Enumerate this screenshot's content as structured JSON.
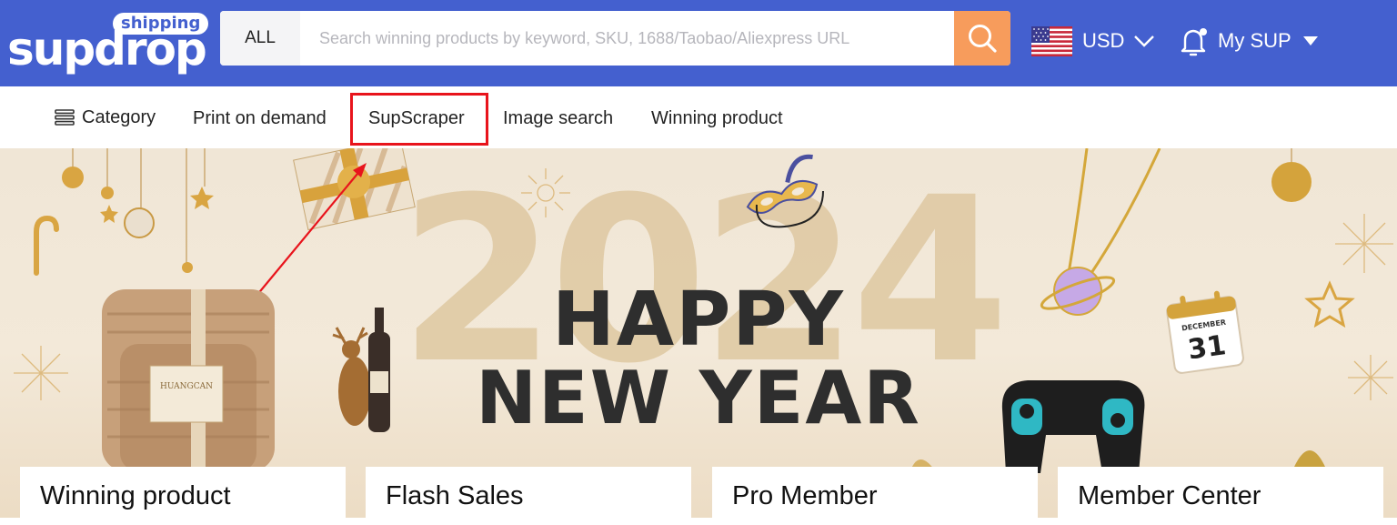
{
  "header": {
    "logo": {
      "tag": "shipping",
      "word": "supdrop"
    },
    "search": {
      "scope": "ALL",
      "placeholder": "Search winning products by keyword, SKU, 1688/Taobao/Aliexpress URL",
      "button_icon": "search-icon"
    },
    "currency": {
      "flag_icon": "us-flag-icon",
      "code": "USD",
      "chevron_icon": "chevron-down-icon"
    },
    "account": {
      "bell_icon": "bell-icon",
      "label": "My SUP",
      "caret_icon": "caret-down-icon"
    }
  },
  "nav": {
    "category_icon": "menu-lines-icon",
    "items": [
      "Category",
      "Print on demand",
      "SupScraper",
      "Image search",
      "Winning product"
    ],
    "highlighted": "SupScraper"
  },
  "banner": {
    "year": "2024",
    "line1": "HAPPY",
    "line2": "NEW YEAR",
    "calendar": {
      "month": "DECEMBER",
      "day": "31"
    },
    "package_label": "HUANGCAN"
  },
  "cards": [
    "Winning product",
    "Flash Sales",
    "Pro Member",
    "Member Center"
  ],
  "colors": {
    "header": "#4460cf",
    "search_button": "#f79c5c",
    "highlight": "#e8141c",
    "banner_bg": "#f0e6d6",
    "headline": "#2e2e2e"
  }
}
